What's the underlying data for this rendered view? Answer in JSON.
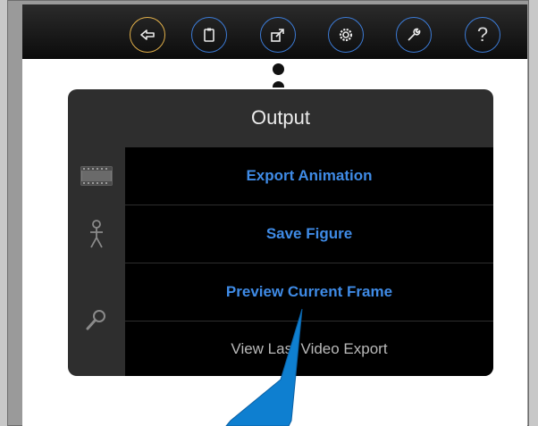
{
  "toolbar": {
    "buttons": [
      {
        "name": "back-button",
        "icon": "back-arrow-icon",
        "active": true
      },
      {
        "name": "clipboard-button",
        "icon": "clipboard-icon",
        "active": false
      },
      {
        "name": "export-button",
        "icon": "export-icon",
        "active": false
      },
      {
        "name": "settings-button",
        "icon": "gear-icon",
        "active": false
      },
      {
        "name": "tools-button",
        "icon": "wrench-icon",
        "active": false
      },
      {
        "name": "help-button",
        "icon": "question-icon",
        "active": false,
        "label": "?"
      }
    ]
  },
  "popover": {
    "title": "Output",
    "items": [
      {
        "label": "Export Animation",
        "icon": "film-strip-icon",
        "style": "blue"
      },
      {
        "label": "Save Figure",
        "icon": "stick-figure-icon",
        "style": "blue"
      },
      {
        "label": "Preview Current Frame",
        "icon": "magnifier-icon",
        "style": "blue"
      },
      {
        "label": "View Last Video Export",
        "icon": "",
        "style": "gray"
      }
    ]
  },
  "colors": {
    "accent_blue": "#3f8be6",
    "active_ring": "#e2b04a",
    "arrow": "#0e7fd0"
  }
}
